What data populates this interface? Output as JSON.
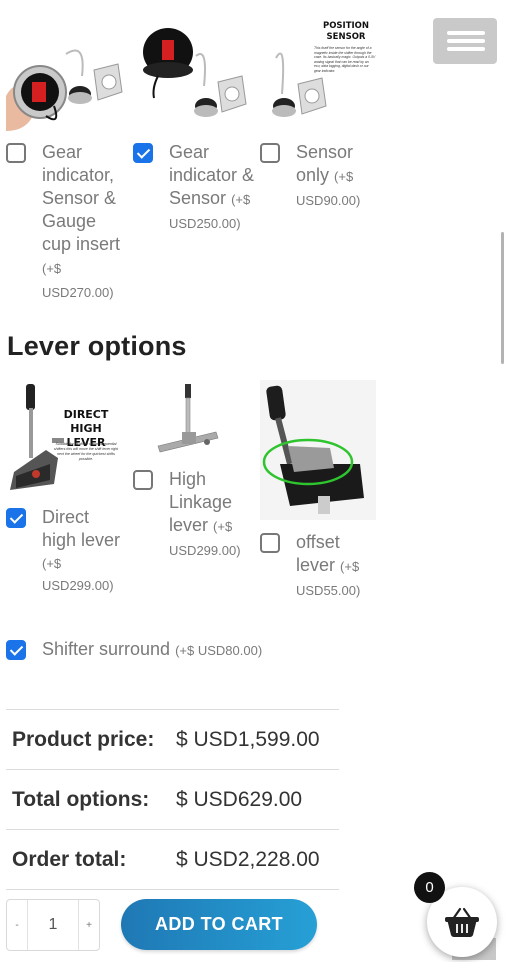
{
  "header": {
    "menu_icon": "hamburger-menu-icon"
  },
  "gear_options": [
    {
      "name": "Gear indicator, Sensor & Gauge cup insert",
      "price": "(+$ USD270.00)",
      "checked": false
    },
    {
      "name": "Gear indicator & Sensor",
      "price": "(+$ USD250.00)",
      "checked": true
    },
    {
      "name": "Sensor only",
      "price": "(+$ USD90.00)",
      "checked": false
    }
  ],
  "sensor_image_text": {
    "title_line1": "POSITION",
    "title_line2": "SENSOR",
    "caption": "This itself the sensor for the angle of a magnetic inside the shifter through the case. Its basically magic. Outputs a 0-5V analog signal that can be read by an ecu, data logging, digital dash or our gear indicator."
  },
  "lever_section": {
    "title": "Lever options",
    "options": [
      {
        "name_line1": "Direct",
        "name_line2": "high lever",
        "price_line1": "(+$",
        "price_line2": "USD299.00)",
        "checked": true
      },
      {
        "name_line1": "High",
        "name_line2": "Linkage",
        "name_line3": "lever",
        "price_line1": "(+$",
        "price_line2": "USD299.00)",
        "checked": false
      },
      {
        "name_line1": "offset",
        "name_line2": "lever",
        "price_line1": "(+$",
        "price_line2": "USD55.00)",
        "checked": false
      }
    ],
    "direct_high_image_text": {
      "title_line1": "DIRECT HIGH",
      "title_line2": "LEVER",
      "caption": "Suitable for all direct mount sequential shifters this will move the shift lever right next the wheel for the quickest shifts possible."
    }
  },
  "surround": {
    "name": "Shifter surround",
    "price": "(+$ USD80.00)",
    "checked": true
  },
  "totals": [
    {
      "label": "Product price:",
      "value": "$ USD1,599.00"
    },
    {
      "label": "Total options:",
      "value": "$ USD629.00"
    },
    {
      "label": "Order total:",
      "value": "$ USD2,228.00"
    }
  ],
  "cart_form": {
    "decrement": "-",
    "quantity": "1",
    "increment": "+",
    "add_button": "ADD TO CART"
  },
  "cart_fab": {
    "count": "0",
    "icon": "shopping-basket-icon"
  },
  "colors": {
    "checkbox_checked": "#1a73e8",
    "button_start": "#1f78b4",
    "button_end": "#26a0d6"
  }
}
